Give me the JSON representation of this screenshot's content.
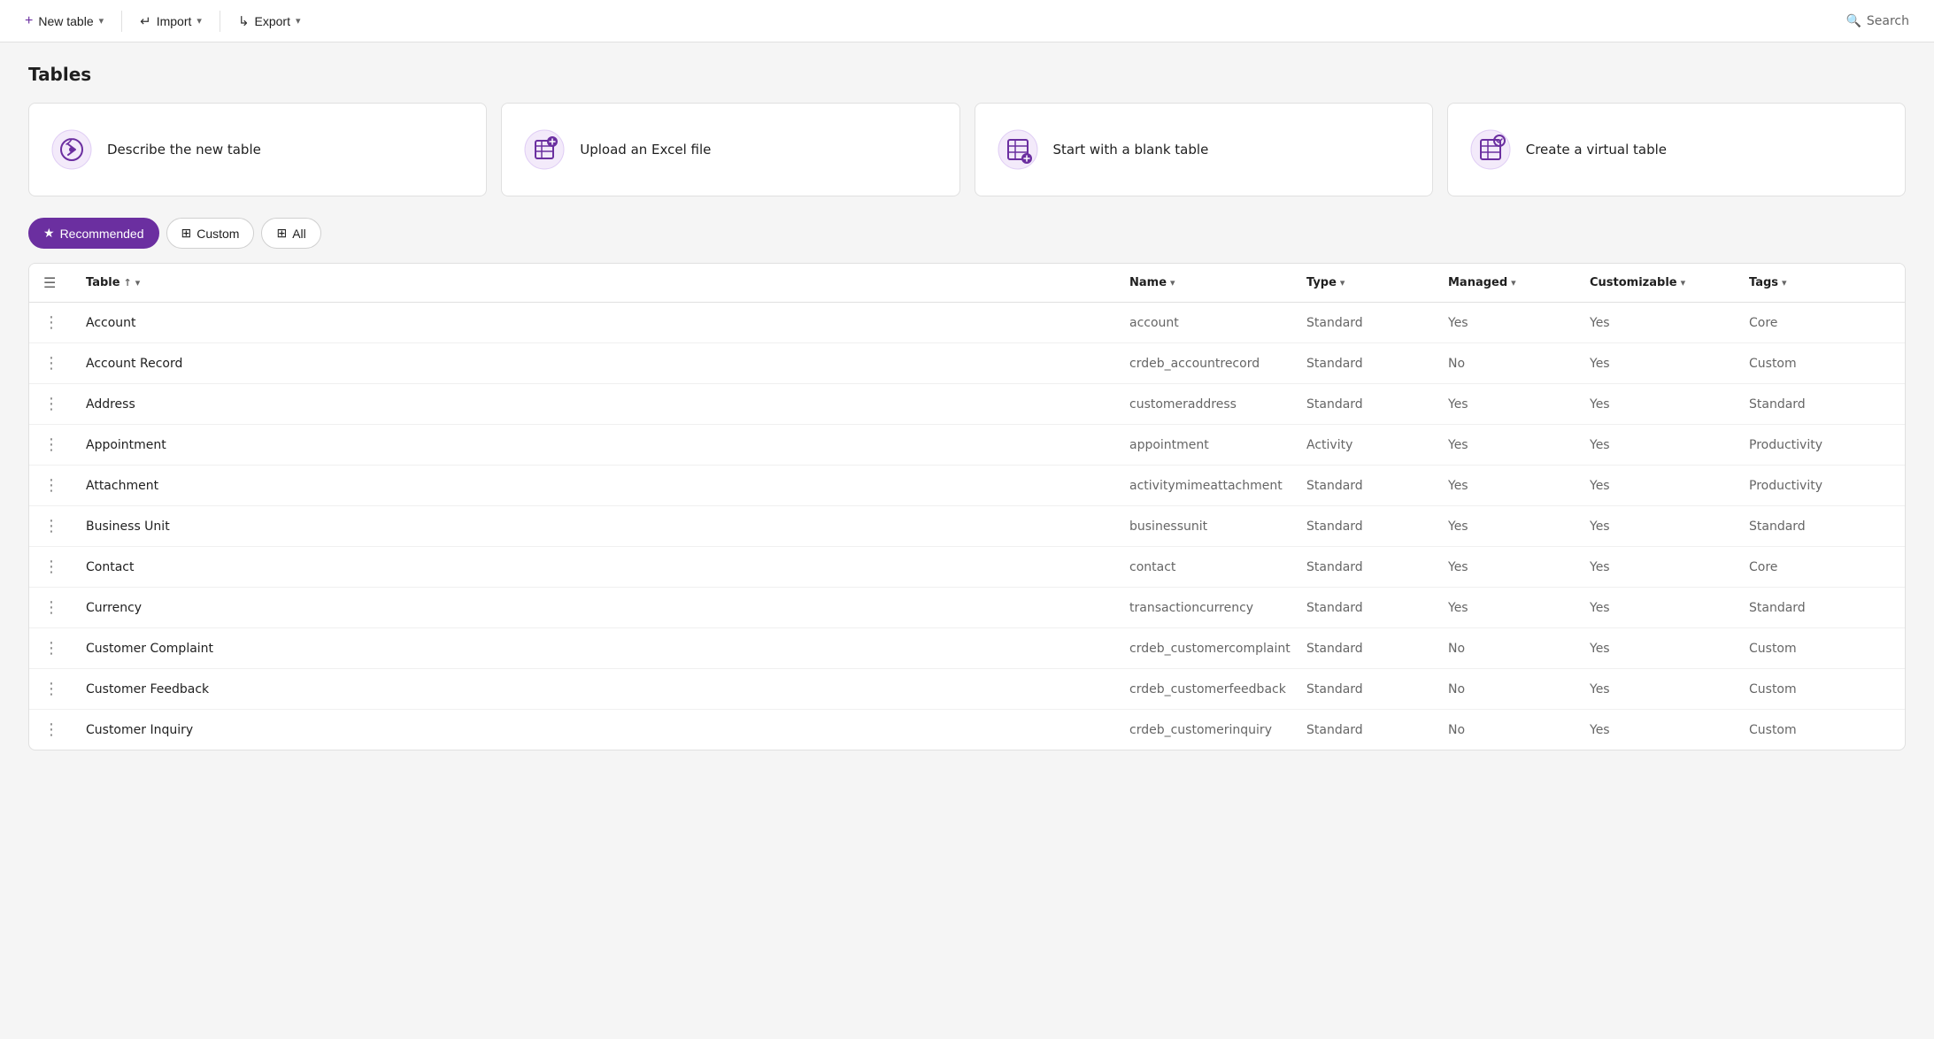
{
  "toolbar": {
    "new_table_label": "New table",
    "import_label": "Import",
    "export_label": "Export",
    "search_label": "Search",
    "new_icon": "+",
    "import_icon": "↵",
    "export_icon": "↳",
    "search_icon": "🔍"
  },
  "page": {
    "title": "Tables"
  },
  "cards": [
    {
      "id": "describe",
      "label": "Describe the new table",
      "icon_type": "ai"
    },
    {
      "id": "upload",
      "label": "Upload an Excel file",
      "icon_type": "excel"
    },
    {
      "id": "blank",
      "label": "Start with a blank table",
      "icon_type": "blank"
    },
    {
      "id": "virtual",
      "label": "Create a virtual table",
      "icon_type": "virtual"
    }
  ],
  "filters": [
    {
      "id": "recommended",
      "label": "Recommended",
      "active": true,
      "icon": "★"
    },
    {
      "id": "custom",
      "label": "Custom",
      "active": false,
      "icon": "⊞"
    },
    {
      "id": "all",
      "label": "All",
      "active": false,
      "icon": "⊞"
    }
  ],
  "table": {
    "columns": [
      {
        "key": "table",
        "label": "Table",
        "sortable": true,
        "sort_dir": "asc"
      },
      {
        "key": "name",
        "label": "Name",
        "sortable": true
      },
      {
        "key": "type",
        "label": "Type",
        "sortable": true
      },
      {
        "key": "managed",
        "label": "Managed",
        "sortable": true
      },
      {
        "key": "customizable",
        "label": "Customizable",
        "sortable": true
      },
      {
        "key": "tags",
        "label": "Tags",
        "sortable": true
      }
    ],
    "rows": [
      {
        "table": "Account",
        "name": "account",
        "type": "Standard",
        "managed": "Yes",
        "customizable": "Yes",
        "tags": "Core"
      },
      {
        "table": "Account Record",
        "name": "crdeb_accountrecord",
        "type": "Standard",
        "managed": "No",
        "customizable": "Yes",
        "tags": "Custom"
      },
      {
        "table": "Address",
        "name": "customeraddress",
        "type": "Standard",
        "managed": "Yes",
        "customizable": "Yes",
        "tags": "Standard"
      },
      {
        "table": "Appointment",
        "name": "appointment",
        "type": "Activity",
        "managed": "Yes",
        "customizable": "Yes",
        "tags": "Productivity"
      },
      {
        "table": "Attachment",
        "name": "activitymimeattachment",
        "type": "Standard",
        "managed": "Yes",
        "customizable": "Yes",
        "tags": "Productivity"
      },
      {
        "table": "Business Unit",
        "name": "businessunit",
        "type": "Standard",
        "managed": "Yes",
        "customizable": "Yes",
        "tags": "Standard"
      },
      {
        "table": "Contact",
        "name": "contact",
        "type": "Standard",
        "managed": "Yes",
        "customizable": "Yes",
        "tags": "Core"
      },
      {
        "table": "Currency",
        "name": "transactioncurrency",
        "type": "Standard",
        "managed": "Yes",
        "customizable": "Yes",
        "tags": "Standard"
      },
      {
        "table": "Customer Complaint",
        "name": "crdeb_customercomplaint",
        "type": "Standard",
        "managed": "No",
        "customizable": "Yes",
        "tags": "Custom"
      },
      {
        "table": "Customer Feedback",
        "name": "crdeb_customerfeedback",
        "type": "Standard",
        "managed": "No",
        "customizable": "Yes",
        "tags": "Custom"
      },
      {
        "table": "Customer Inquiry",
        "name": "crdeb_customerinquiry",
        "type": "Standard",
        "managed": "No",
        "customizable": "Yes",
        "tags": "Custom"
      }
    ]
  }
}
